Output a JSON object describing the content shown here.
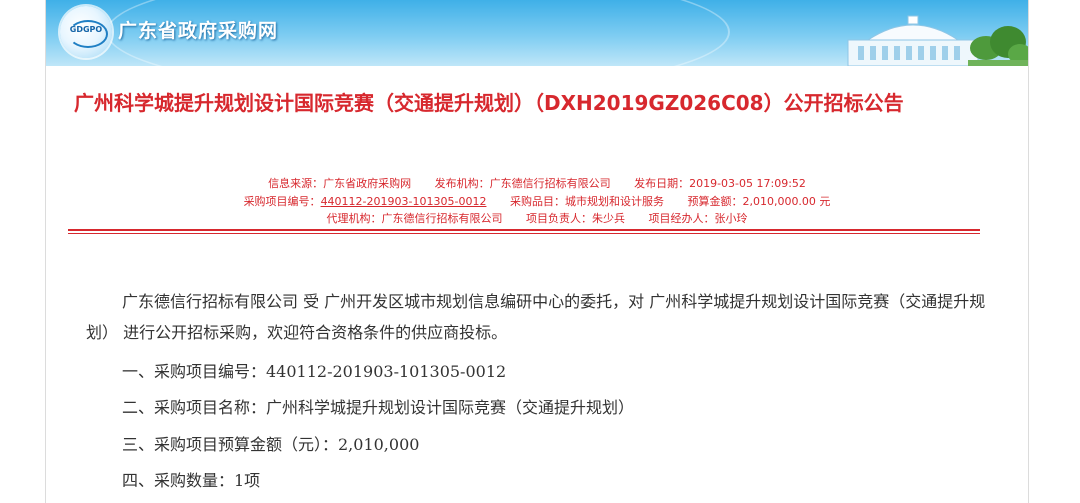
{
  "header": {
    "logo_text": "GDGPO",
    "site_name": "广东省政府采购网"
  },
  "notice": {
    "title": "广州科学城提升规划设计国际竞赛（交通提升规划）（DXH2019GZ026C08）公开招标公告",
    "meta_row1": {
      "source_label": "信息来源：",
      "source": "广东省政府采购网",
      "publisher_label": "发布机构：",
      "publisher": "广东德信行招标有限公司",
      "date_label": "发布日期：",
      "date": "2019-03-05 17:09:52"
    },
    "meta_row2": {
      "project_no_label": "采购项目编号：",
      "project_no": "440112-201903-101305-0012",
      "category_label": "采购品目：",
      "category": "城市规划和设计服务",
      "budget_label": "预算金额：",
      "budget": "2,010,000.00 元"
    },
    "meta_row3": {
      "agency_label": "代理机构：",
      "agency": "广东德信行招标有限公司",
      "manager_label": "项目负责人：",
      "manager": "朱少兵",
      "handler_label": "项目经办人：",
      "handler": "张小玲"
    },
    "intro": "广东德信行招标有限公司 受 广州开发区城市规划信息编研中心的委托，对 广州科学城提升规划设计国际竞赛（交通提升规划） 进行公开招标采购，欢迎符合资格条件的供应商投标。",
    "items": [
      "一、采购项目编号：440112-201903-101305-0012",
      "二、采购项目名称：广州科学城提升规划设计国际竞赛（交通提升规划）",
      "三、采购项目预算金额（元）：2,010,000",
      "四、采购数量：1项"
    ]
  }
}
